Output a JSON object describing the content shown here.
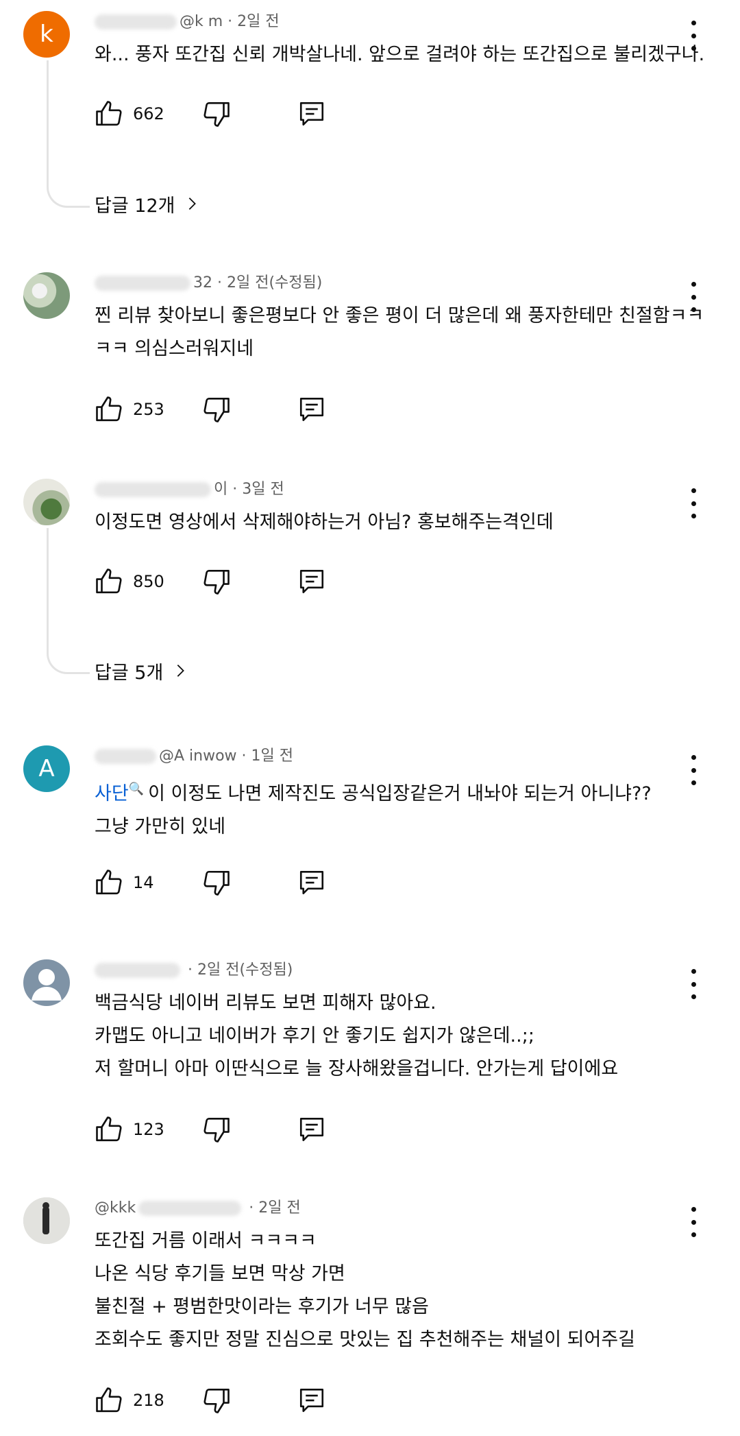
{
  "comments": [
    {
      "avatar_letter": "k",
      "avatar_color": "#ef6c00",
      "author": "@k     m",
      "time": "2일 전",
      "lines": [
        "와... 풍자 또간집 신뢰 개박살나네. 앞으로 걸려야 하는 또간집으로 불리겠구나."
      ],
      "likes": "662",
      "replies": "답글 12개"
    },
    {
      "avatar_letter": "",
      "avatar_color": "#8ea6b8",
      "author": "32",
      "time": "2일 전(수정됨)",
      "lines": [
        "찐 리뷰 찾아보니 좋은평보다 안 좋은 평이 더 많은데 왜 풍자한테만 친절함ㅋㅋ",
        "ㅋㅋ 의심스러워지네"
      ],
      "likes": "253"
    },
    {
      "avatar_letter": "",
      "avatar_color": "#8a9a7e",
      "author": "이",
      "time": "3일 전",
      "lines": [
        "이정도면 영상에서 삭제해야하는거 아님? 홍보해주는격인데"
      ],
      "likes": "850",
      "replies": "답글 5개"
    },
    {
      "avatar_letter": "A",
      "avatar_color": "#1e9ab0",
      "author": "@A    inwow",
      "time": "1일 전",
      "link_text": "사단",
      "link_icon": "🔍",
      "lines": [
        "이 이정도 나면 제작진도 공식입장같은거 내놔야 되는거 아니냐??",
        "그냥 가만히 있네"
      ],
      "likes": "14"
    },
    {
      "avatar_letter": "",
      "avatar_color": "#7f93a6",
      "author": "",
      "time": "2일 전(수정됨)",
      "lines": [
        "백금식당 네이버 리뷰도 보면 피해자 많아요.",
        "카맵도 아니고 네이버가 후기 안 좋기도 쉽지가 않은데..;;",
        "저 할머니 아마 이딴식으로 늘 장사해왔을겁니다. 안가는게 답이에요"
      ],
      "likes": "123"
    },
    {
      "avatar_letter": "",
      "avatar_color": "#d8d8d4",
      "author": "@kkk",
      "time": "2일 전",
      "lines": [
        "또간집 거름 이래서 ㅋㅋㅋㅋ",
        "나온 식당 후기들 보면 막상 가면",
        "불친절 + 평범한맛이라는 후기가 너무 많음",
        "조회수도 좋지만 정말 진심으로 맛있는 집 추천해주는 채널이 되어주길"
      ],
      "likes": "218"
    }
  ]
}
